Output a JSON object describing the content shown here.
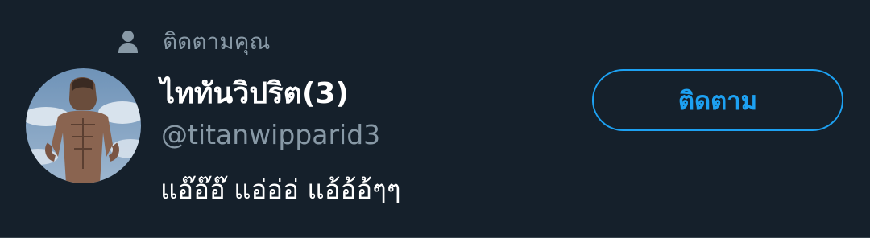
{
  "follows_you": {
    "icon": "person-icon",
    "label": "ติดตามคุณ"
  },
  "user": {
    "avatar": "avatar-image",
    "display_name": "ไททันวิปริต(3)",
    "handle": "@titanwipparid3",
    "bio": "แอ๊อ๊อ๊ แอ่อ่อ่ แอ้อ้อ้ๆๆ"
  },
  "follow_button": {
    "label": "ติดตาม"
  },
  "colors": {
    "background": "#15202b",
    "secondary_text": "#8899a6",
    "primary_text": "#ffffff",
    "accent": "#1da1f2",
    "divider": "#38444d"
  }
}
